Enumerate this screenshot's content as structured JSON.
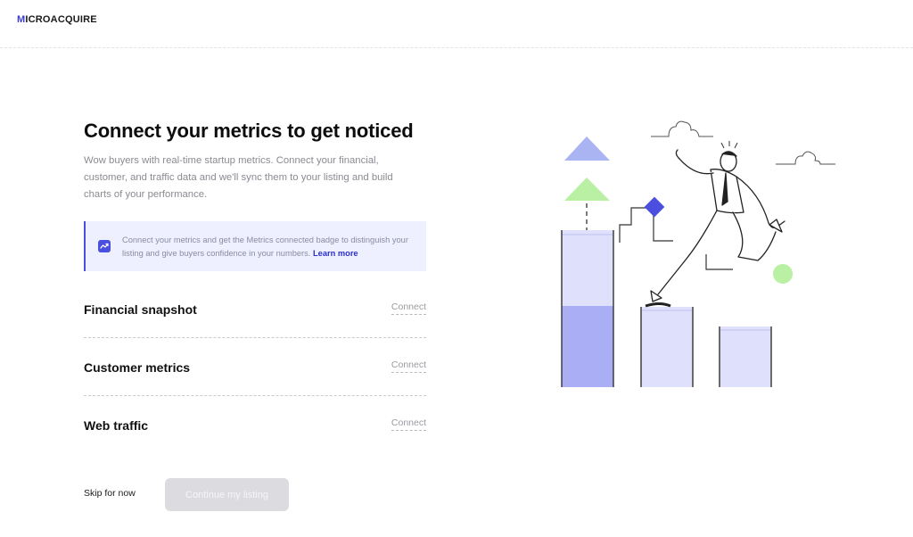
{
  "header": {
    "logo_initial": "M",
    "logo_rest": "ICROACQUIRE"
  },
  "main": {
    "title": "Connect your metrics to get noticed",
    "subtitle": "Wow buyers with real-time startup metrics. Connect your financial, customer, and traffic data and we'll sync them to your listing and build charts of your performance."
  },
  "info_banner": {
    "text": "Connect your metrics and get the Metrics connected badge to distinguish your listing and give buyers confidence in your numbers.",
    "link_label": "Learn more",
    "icon": "chart-line-icon"
  },
  "metrics": [
    {
      "label": "Financial snapshot",
      "action": "Connect"
    },
    {
      "label": "Customer metrics",
      "action": "Connect"
    },
    {
      "label": "Web traffic",
      "action": "Connect"
    }
  ],
  "footer": {
    "skip_label": "Skip for now",
    "continue_label": "Continue my listing"
  },
  "colors": {
    "accent": "#4b4fe0",
    "info_bg": "#eef0ff",
    "bar_light": "#dfe0fb",
    "bar_dark": "#a9aef5",
    "green": "#b9f0a3",
    "triangle_blue": "#aab4f3"
  }
}
